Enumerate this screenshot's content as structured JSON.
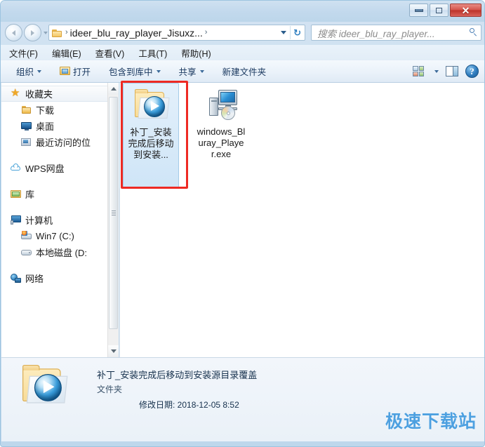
{
  "window": {
    "controls": {
      "minimize": "—",
      "maximize": "□",
      "close": "✕"
    }
  },
  "address": {
    "crumb": "ideer_blu_ray_player_Jisuxz...",
    "separator": "›",
    "refresh_icon": "↻"
  },
  "search": {
    "placeholder": "搜索 ideer_blu_ray_player...",
    "value": "搜索 ideer_blu_ray_player..."
  },
  "menubar": {
    "items": [
      {
        "label": "文件(F)"
      },
      {
        "label": "编辑(E)"
      },
      {
        "label": "查看(V)"
      },
      {
        "label": "工具(T)"
      },
      {
        "label": "帮助(H)"
      }
    ]
  },
  "toolbar": {
    "organize": "组织",
    "open": "打开",
    "include_in_library": "包含到库中",
    "share": "共享",
    "new_folder": "新建文件夹",
    "help_glyph": "?"
  },
  "sidebar": {
    "items": [
      {
        "label": "收藏夹",
        "icon": "star-icon",
        "level": 0,
        "selected": true
      },
      {
        "label": "下载",
        "icon": "folder-icon",
        "level": 1,
        "selected": false
      },
      {
        "label": "桌面",
        "icon": "desktop-monitor-icon",
        "level": 1,
        "selected": false
      },
      {
        "label": "最近访问的位",
        "icon": "recent-places-icon",
        "level": 1,
        "selected": false
      },
      {
        "label": "WPS网盘",
        "icon": "cloud-icon",
        "level": 0,
        "selected": false
      },
      {
        "label": "库",
        "icon": "library-icon",
        "level": 0,
        "selected": false
      },
      {
        "label": "计算机",
        "icon": "computer-icon",
        "level": 0,
        "selected": false
      },
      {
        "label": "Win7 (C:)",
        "icon": "windows-drive-icon",
        "level": 1,
        "selected": false
      },
      {
        "label": "本地磁盘 (D:",
        "icon": "drive-icon",
        "level": 1,
        "selected": false
      },
      {
        "label": "网络",
        "icon": "network-icon",
        "level": 0,
        "selected": false
      }
    ]
  },
  "files": [
    {
      "name": "补丁_安​装完成​后移动​到安装...",
      "icon": "folder-media-icon",
      "selected": true,
      "highlighted": true
    },
    {
      "name": "window​s_Bluray​_Player.​exe",
      "icon": "application-exe-icon",
      "selected": false,
      "highlighted": false
    }
  ],
  "status": {
    "name": "补丁_安装完成后移动到安装源目录覆盖",
    "type": "文件夹",
    "date_label": "修改日期: 2018-12-05 8:52",
    "icon": "folder-media-icon"
  },
  "watermark": {
    "text": "极速下载站"
  },
  "colors": {
    "highlight_red": "#ee2a23",
    "selection_blue": "#cfe5f7",
    "titlebar_blue": "#c3d9ed",
    "watermark_blue": "#4da0e0",
    "close_red": "#d4544b"
  }
}
